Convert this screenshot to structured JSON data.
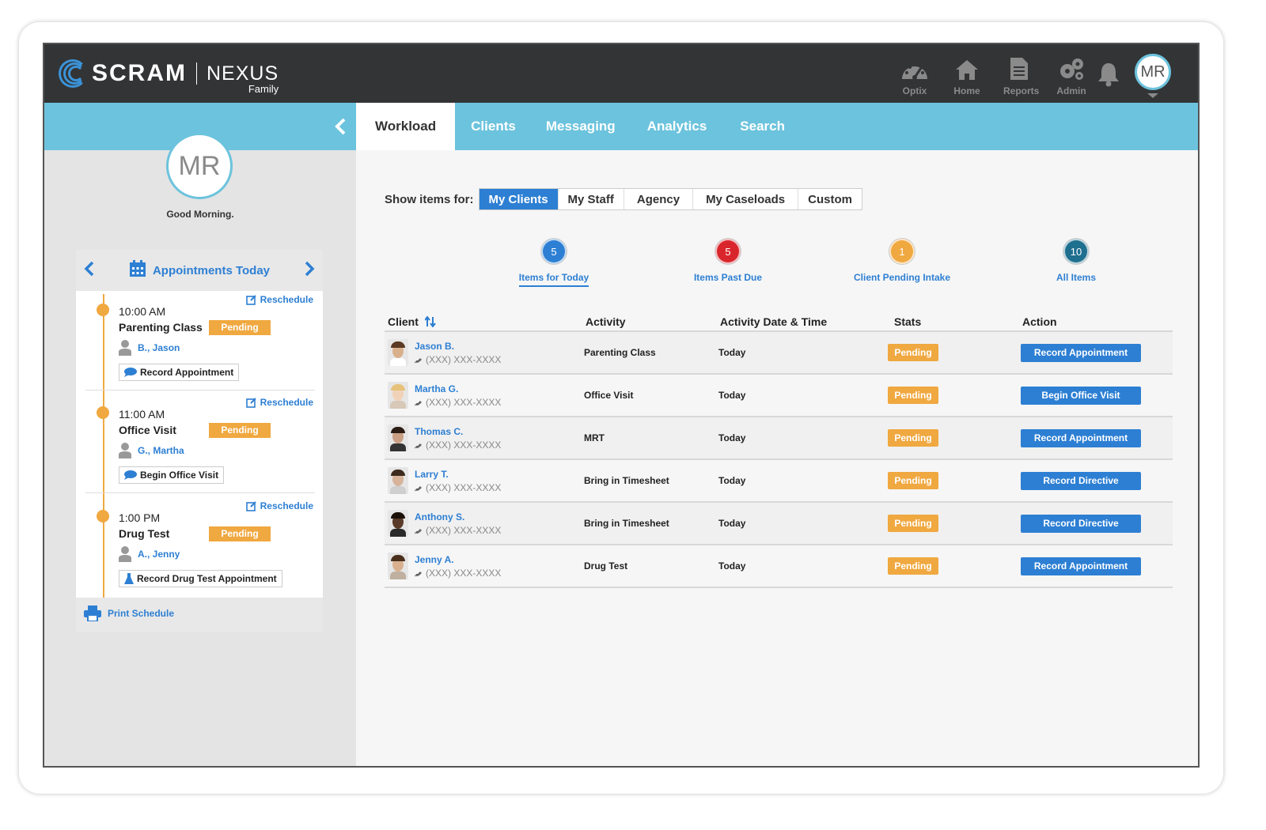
{
  "brand": {
    "scram": "SCRAM",
    "nexus": "NEXUS",
    "family": "Family"
  },
  "topnav": [
    {
      "label": "Optix",
      "icon": "gauge-icon"
    },
    {
      "label": "Home",
      "icon": "home-icon"
    },
    {
      "label": "Reports",
      "icon": "document-icon"
    },
    {
      "label": "Admin",
      "icon": "gears-icon"
    }
  ],
  "user": {
    "initials": "MR",
    "greeting": "Good Morning."
  },
  "tabs": [
    "Workload",
    "Clients",
    "Messaging",
    "Analytics",
    "Search"
  ],
  "appointments": {
    "title": "Appointments Today",
    "items": [
      {
        "time": "10:00 AM",
        "name": "Parenting Class",
        "status": "Pending",
        "client": "B., Jason",
        "action": "Record Appointment",
        "reschedule": "Reschedule"
      },
      {
        "time": "11:00 AM",
        "name": "Office Visit",
        "status": "Pending",
        "client": "G., Martha",
        "action": "Begin Office Visit",
        "reschedule": "Reschedule"
      },
      {
        "time": "1:00 PM",
        "name": "Drug Test",
        "status": "Pending",
        "client": "A., Jenny",
        "action": "Record Drug Test Appointment",
        "reschedule": "Reschedule"
      }
    ],
    "print": "Print Schedule"
  },
  "filter": {
    "label": "Show items for:",
    "options": [
      "My Clients",
      "My Staff",
      "Agency",
      "My Caseloads",
      "Custom"
    ],
    "selected": "My Clients"
  },
  "counters": [
    {
      "count": "5",
      "label": "Items for Today",
      "color": "#2d7fd3"
    },
    {
      "count": "5",
      "label": "Items Past Due",
      "color": "#d9262c"
    },
    {
      "count": "1",
      "label": "Client Pending Intake",
      "color": "#f0a840"
    },
    {
      "count": "10",
      "label": "All Items",
      "color": "#1f6f8f"
    }
  ],
  "table": {
    "headers": {
      "client": "Client",
      "activity": "Activity",
      "date": "Activity Date & Time",
      "stats": "Stats",
      "action": "Action"
    },
    "rows": [
      {
        "name": "Jason B.",
        "phone": "(XXX) XXX-XXXX",
        "activity": "Parenting Class",
        "date": "Today",
        "status": "Pending",
        "action": "Record Appointment"
      },
      {
        "name": "Martha G.",
        "phone": "(XXX) XXX-XXXX",
        "activity": "Office Visit",
        "date": "Today",
        "status": "Pending",
        "action": "Begin Office Visit"
      },
      {
        "name": "Thomas C.",
        "phone": "(XXX) XXX-XXXX",
        "activity": "MRT",
        "date": "Today",
        "status": "Pending",
        "action": "Record Appointment"
      },
      {
        "name": "Larry T.",
        "phone": "(XXX) XXX-XXXX",
        "activity": "Bring in Timesheet",
        "date": "Today",
        "status": "Pending",
        "action": "Record Directive"
      },
      {
        "name": "Anthony S.",
        "phone": "(XXX) XXX-XXXX",
        "activity": "Bring in Timesheet",
        "date": "Today",
        "status": "Pending",
        "action": "Record Directive"
      },
      {
        "name": "Jenny A.",
        "phone": "(XXX) XXX-XXXX",
        "activity": "Drug Test",
        "date": "Today",
        "status": "Pending",
        "action": "Record Appointment"
      }
    ]
  }
}
